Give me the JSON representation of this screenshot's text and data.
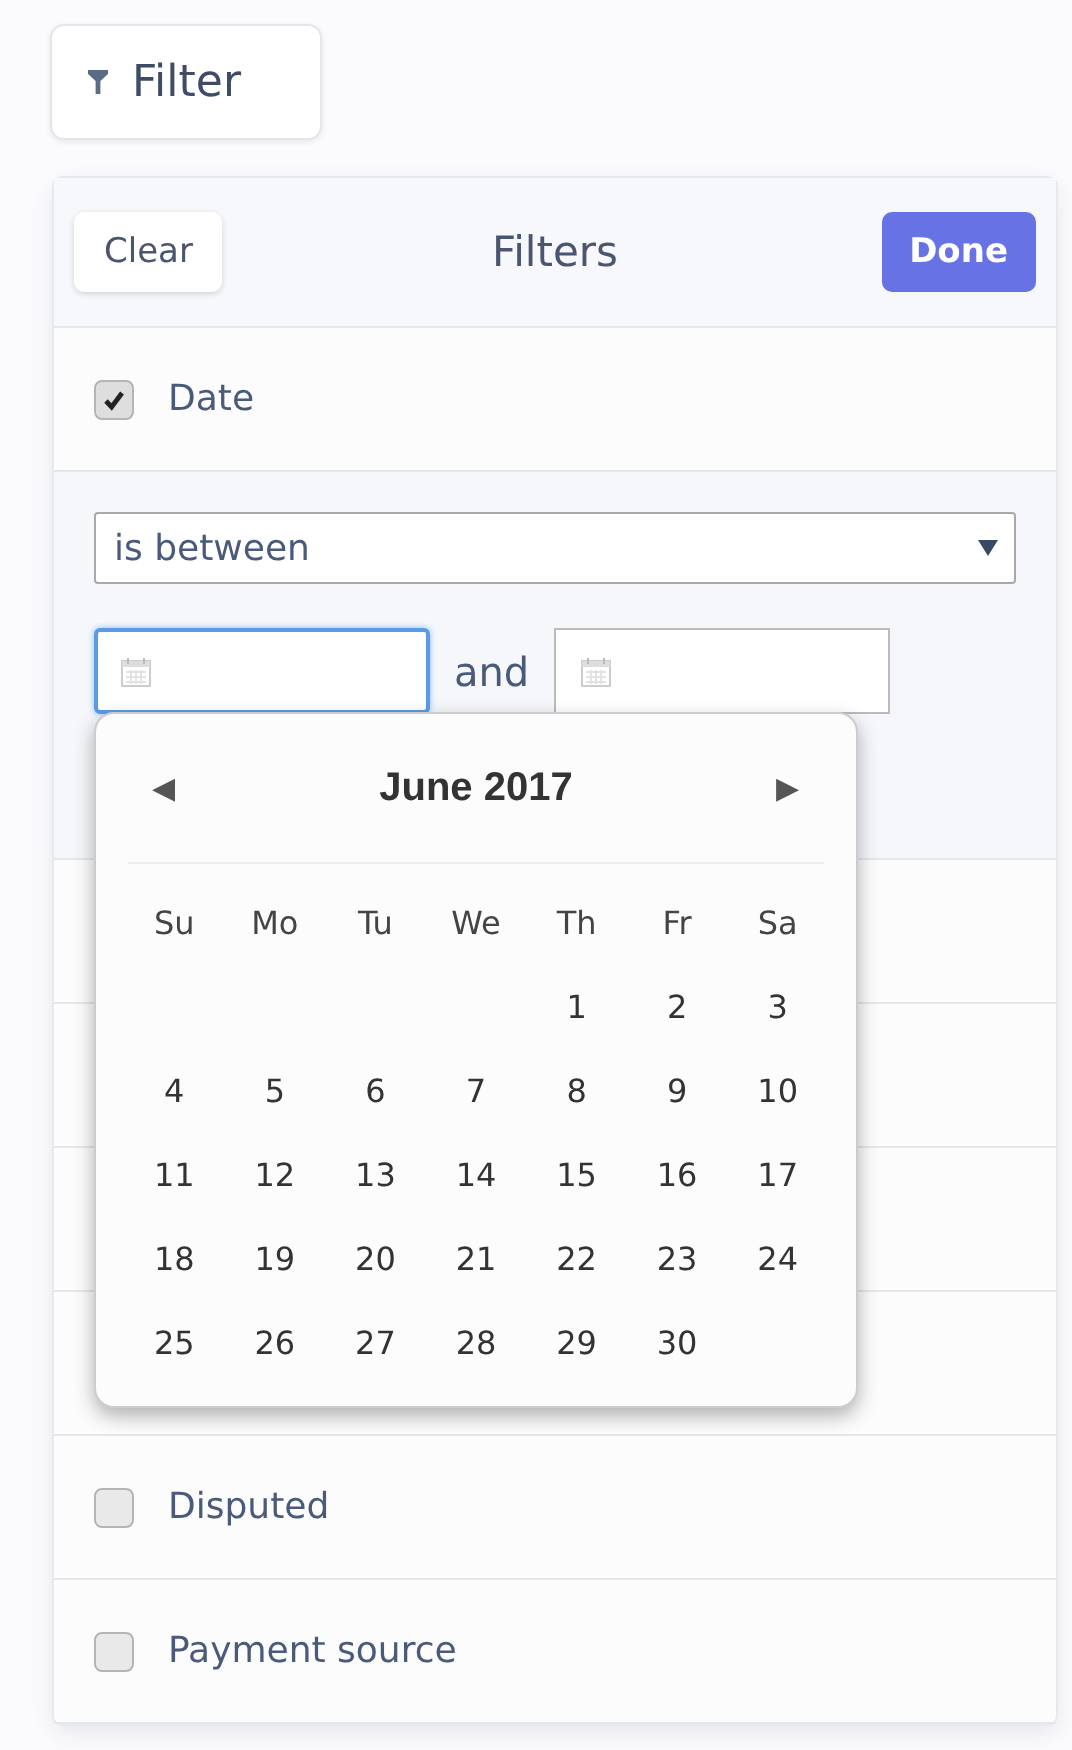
{
  "filter_button": {
    "label": "Filter"
  },
  "panel": {
    "title": "Filters",
    "clear": "Clear",
    "done": "Done",
    "filters": [
      {
        "label": "Date",
        "checked": true,
        "expanded": true
      },
      {
        "label": "Disputed",
        "checked": false,
        "expanded": false
      },
      {
        "label": "Payment source",
        "checked": false,
        "expanded": false
      }
    ],
    "date_filter": {
      "operator": "is between",
      "conjunction": "and",
      "start_focused": true
    },
    "calendar": {
      "month": "June 2017",
      "prev": "◀",
      "next": "▶",
      "weekdays": [
        "Su",
        "Mo",
        "Tu",
        "We",
        "Th",
        "Fr",
        "Sa"
      ],
      "weeks": [
        {
          "kind": "first",
          "days": [
            "1",
            "2",
            "3"
          ]
        },
        {
          "kind": "full",
          "days": [
            "4",
            "5",
            "6",
            "7",
            "8",
            "9",
            "10"
          ]
        },
        {
          "kind": "full",
          "days": [
            "11",
            "12",
            "13",
            "14",
            "15",
            "16",
            "17"
          ]
        },
        {
          "kind": "full",
          "days": [
            "18",
            "19",
            "20",
            "21",
            "22",
            "23",
            "24"
          ]
        },
        {
          "kind": "last",
          "days": [
            "25",
            "26",
            "27",
            "28",
            "29",
            "30"
          ]
        }
      ]
    }
  }
}
